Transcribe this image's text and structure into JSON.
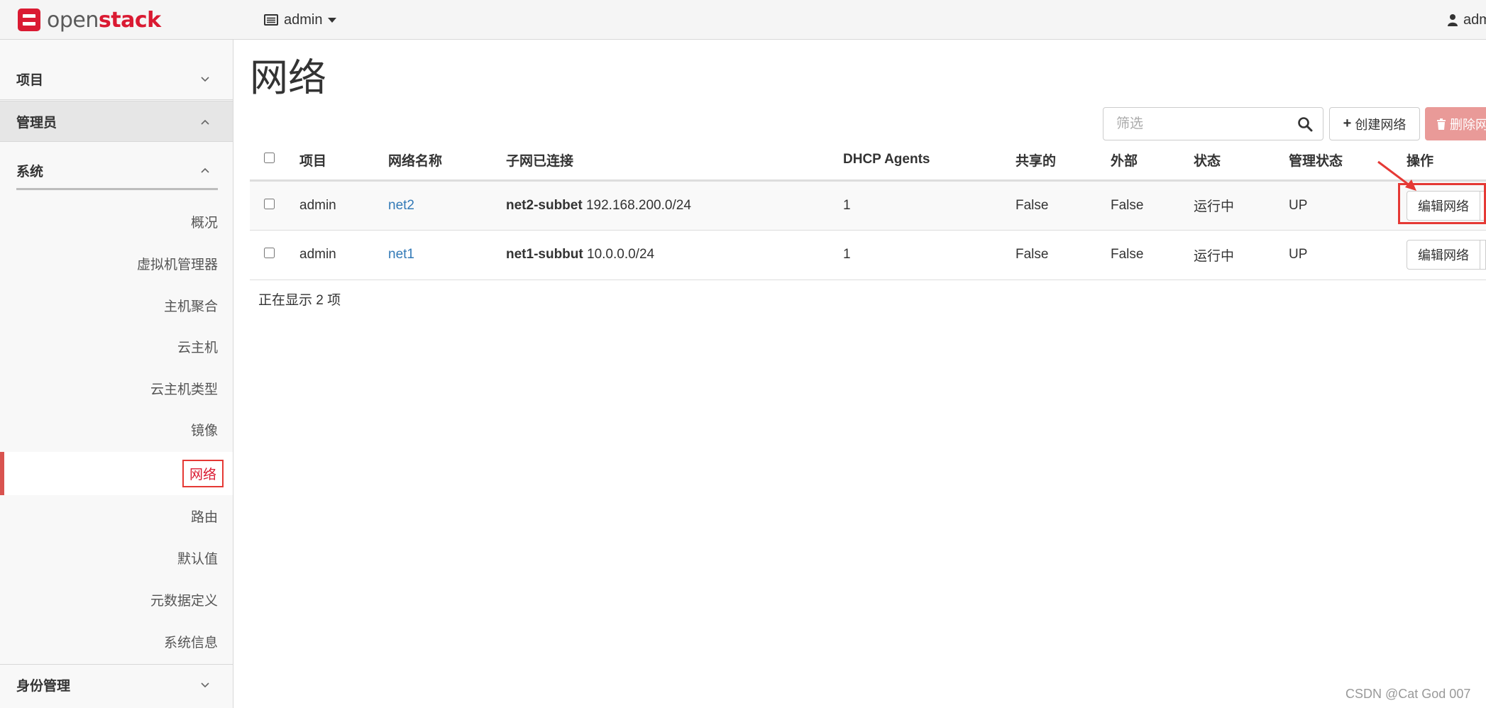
{
  "topbar": {
    "logo_text_a": "open",
    "logo_text_b": "stack",
    "project": "admin",
    "user": "adm"
  },
  "sidebar": {
    "sections": [
      {
        "label": "项目",
        "expanded": false
      },
      {
        "label": "管理员",
        "expanded": true
      },
      {
        "label": "身份管理",
        "expanded": false
      }
    ],
    "subsection": {
      "label": "系统",
      "expanded": true
    },
    "items": [
      {
        "label": "概况"
      },
      {
        "label": "虚拟机管理器"
      },
      {
        "label": "主机聚合"
      },
      {
        "label": "云主机"
      },
      {
        "label": "云主机类型"
      },
      {
        "label": "镜像"
      },
      {
        "label": "网络",
        "active": true
      },
      {
        "label": "路由"
      },
      {
        "label": "默认值"
      },
      {
        "label": "元数据定义"
      },
      {
        "label": "系统信息"
      }
    ]
  },
  "main": {
    "title": "网络",
    "filter_placeholder": "筛选",
    "create_label": "创建网络",
    "delete_label": "删除网络",
    "columns": [
      "项目",
      "网络名称",
      "子网已连接",
      "DHCP Agents",
      "共享的",
      "外部",
      "状态",
      "管理状态",
      "操作"
    ],
    "rows": [
      {
        "project": "admin",
        "name": "net2",
        "subnet_name": "net2-subbet",
        "subnet_cidr": "192.168.200.0/24",
        "dhcp": "1",
        "shared": "False",
        "external": "False",
        "status": "运行中",
        "admin_state": "UP",
        "action": "编辑网络"
      },
      {
        "project": "admin",
        "name": "net1",
        "subnet_name": "net1-subbut",
        "subnet_cidr": "10.0.0.0/24",
        "dhcp": "1",
        "shared": "False",
        "external": "False",
        "status": "运行中",
        "admin_state": "UP",
        "action": "编辑网络"
      }
    ],
    "count_text": "正在显示 2 项"
  },
  "watermark": "CSDN @Cat God 007",
  "colors": {
    "brand": "#da1a32",
    "link": "#337ab7",
    "danger": "#d9534f",
    "highlight": "#e53935"
  }
}
